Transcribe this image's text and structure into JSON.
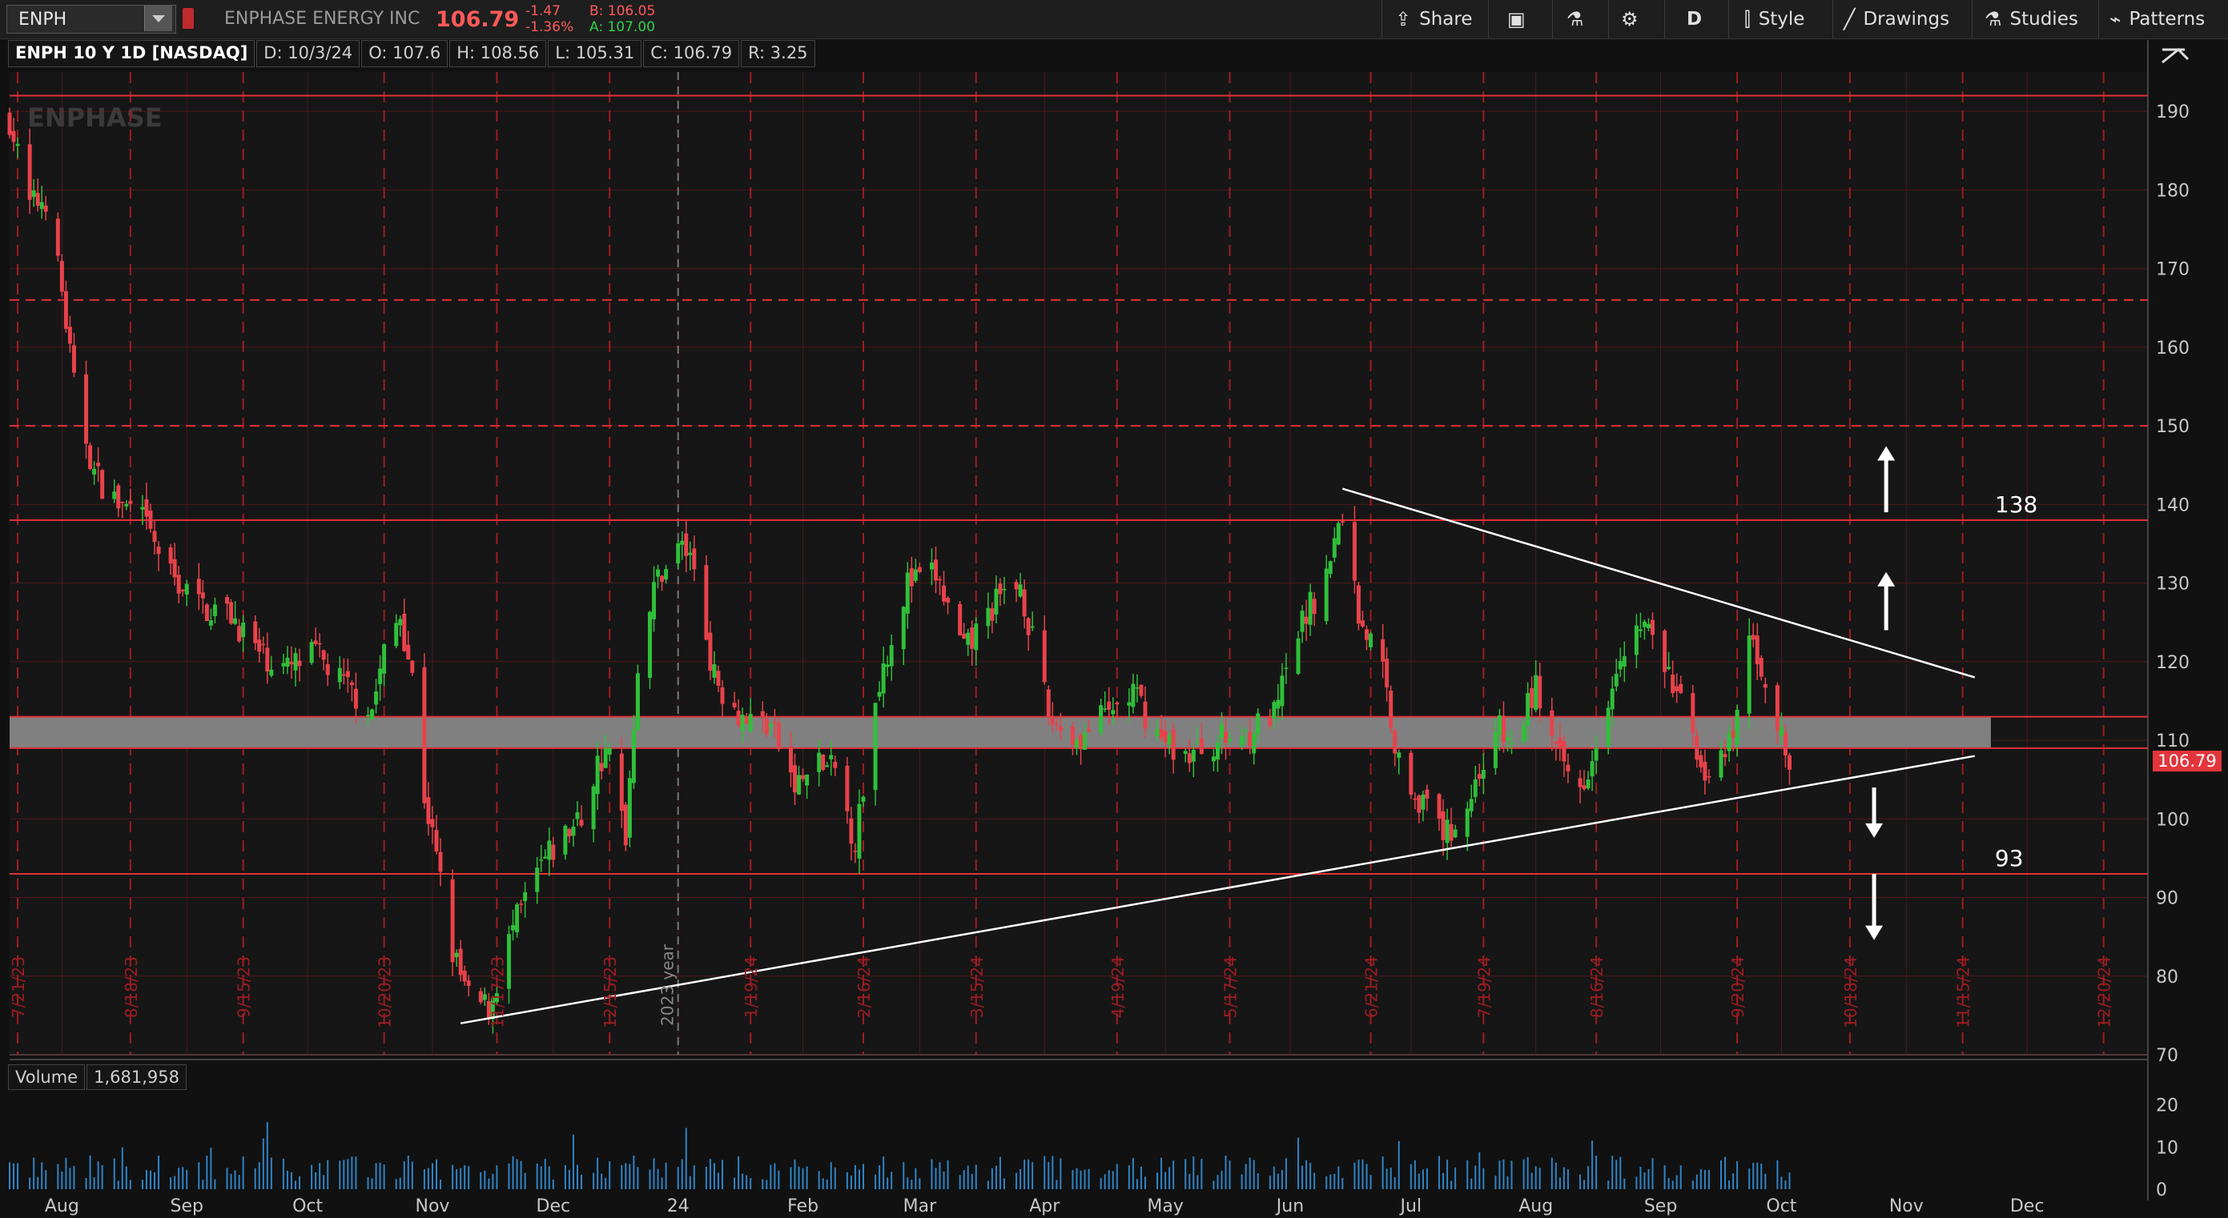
{
  "header": {
    "symbol": "ENPH",
    "company": "ENPHASE ENERGY INC",
    "last": "106.79",
    "change": "-1.47",
    "change_pct": "-1.36%",
    "bid": "B: 106.05",
    "ask": "A: 107.00",
    "toolbar": {
      "share": "Share",
      "interval": "D",
      "style": "Style",
      "drawings": "Drawings",
      "studies": "Studies",
      "patterns": "Patterns"
    }
  },
  "info": {
    "title": "ENPH 10 Y 1D [NASDAQ]",
    "date": "D: 10/3/24",
    "open": "O: 107.6",
    "high": "H: 108.56",
    "low": "L: 105.31",
    "close": "C: 106.79",
    "range": "R: 3.25"
  },
  "watermark": "ENPHASE",
  "volume": {
    "label": "Volume",
    "value": "1,681,958",
    "ticks": [
      "20",
      "10",
      "0"
    ]
  },
  "colors": {
    "up": "#2fbf3a",
    "down": "#e8424b",
    "grid": "#7a1a1e",
    "zone": "#808080",
    "trend": "#ffffff",
    "volume": "#2f84c6",
    "price_tag": "#e2363c"
  },
  "chart_data": {
    "type": "candlestick",
    "x_range": [
      "2023-07-19",
      "2024-12-31"
    ],
    "ylim": [
      70,
      195
    ],
    "y_ticks": [
      190,
      180,
      170,
      160,
      150,
      140,
      130,
      120,
      110,
      100,
      90,
      80,
      70
    ],
    "month_labels": [
      {
        "date": "2023-08-01",
        "label": "Aug"
      },
      {
        "date": "2023-09-01",
        "label": "Sep"
      },
      {
        "date": "2023-10-01",
        "label": "Oct"
      },
      {
        "date": "2023-11-01",
        "label": "Nov"
      },
      {
        "date": "2023-12-01",
        "label": "Dec"
      },
      {
        "date": "2024-01-01",
        "label": "24"
      },
      {
        "date": "2024-02-01",
        "label": "Feb"
      },
      {
        "date": "2024-03-01",
        "label": "Mar"
      },
      {
        "date": "2024-04-01",
        "label": "Apr"
      },
      {
        "date": "2024-05-01",
        "label": "May"
      },
      {
        "date": "2024-06-01",
        "label": "Jun"
      },
      {
        "date": "2024-07-01",
        "label": "Jul"
      },
      {
        "date": "2024-08-01",
        "label": "Aug"
      },
      {
        "date": "2024-09-01",
        "label": "Sep"
      },
      {
        "date": "2024-10-01",
        "label": "Oct"
      },
      {
        "date": "2024-11-01",
        "label": "Nov"
      },
      {
        "date": "2024-12-01",
        "label": "Dec"
      }
    ],
    "expiry_labels": [
      {
        "date": "2023-07-21",
        "label": "7/21/23"
      },
      {
        "date": "2023-08-18",
        "label": "8/18/23"
      },
      {
        "date": "2023-09-15",
        "label": "9/15/23"
      },
      {
        "date": "2023-10-20",
        "label": "10/20/23"
      },
      {
        "date": "2023-11-17",
        "label": "11/17/23"
      },
      {
        "date": "2023-12-15",
        "label": "12/15/23"
      },
      {
        "date": "2024-01-19",
        "label": "1/19/24"
      },
      {
        "date": "2024-02-16",
        "label": "2/16/24"
      },
      {
        "date": "2024-03-15",
        "label": "3/15/24"
      },
      {
        "date": "2024-04-19",
        "label": "4/19/24"
      },
      {
        "date": "2024-05-17",
        "label": "5/17/24"
      },
      {
        "date": "2024-06-21",
        "label": "6/21/24"
      },
      {
        "date": "2024-07-19",
        "label": "7/19/24"
      },
      {
        "date": "2024-08-16",
        "label": "8/16/24"
      },
      {
        "date": "2024-09-20",
        "label": "9/20/24"
      },
      {
        "date": "2024-10-18",
        "label": "10/18/24"
      },
      {
        "date": "2024-11-15",
        "label": "11/15/24"
      },
      {
        "date": "2024-12-20",
        "label": "12/20/24"
      }
    ],
    "year_marker": {
      "date": "2024-01-01",
      "label": "2023 year"
    },
    "h_lines_solid": [
      192,
      138,
      93
    ],
    "h_lines_dashed": [
      166,
      150
    ],
    "zone": [
      109,
      113
    ],
    "zone_end": "2024-11-22",
    "trendlines": [
      {
        "x1": "2023-11-08",
        "y1": 74,
        "x2": "2024-11-18",
        "y2": 108
      },
      {
        "x1": "2024-06-14",
        "y1": 142,
        "x2": "2024-11-18",
        "y2": 118
      }
    ],
    "arrows": [
      {
        "date": "2024-10-27",
        "from": 139,
        "to": 147,
        "dir": "up"
      },
      {
        "date": "2024-10-27",
        "from": 124,
        "to": 131,
        "dir": "up"
      },
      {
        "date": "2024-10-24",
        "from": 104,
        "to": 98,
        "dir": "down"
      },
      {
        "date": "2024-10-24",
        "from": 93,
        "to": 85,
        "dir": "down"
      }
    ],
    "level_labels": [
      {
        "date": "2024-11-23",
        "value": 138,
        "label": "138"
      },
      {
        "date": "2024-11-23",
        "value": 93,
        "label": "93"
      }
    ],
    "price_tag": "106.79",
    "series": [
      {
        "name": "ENPH",
        "points": [
          [
            "2023-07-19",
            189
          ],
          [
            "2023-07-24",
            178
          ],
          [
            "2023-07-28",
            179
          ],
          [
            "2023-08-01",
            167
          ],
          [
            "2023-08-04",
            155
          ],
          [
            "2023-08-09",
            144
          ],
          [
            "2023-08-15",
            140
          ],
          [
            "2023-08-21",
            138
          ],
          [
            "2023-08-28",
            131
          ],
          [
            "2023-09-05",
            127
          ],
          [
            "2023-09-12",
            126
          ],
          [
            "2023-09-19",
            121
          ],
          [
            "2023-09-26",
            119
          ],
          [
            "2023-10-03",
            121
          ],
          [
            "2023-10-10",
            117
          ],
          [
            "2023-10-17",
            114
          ],
          [
            "2023-10-20",
            121
          ],
          [
            "2023-10-24",
            126
          ],
          [
            "2023-10-27",
            118
          ],
          [
            "2023-10-30",
            103
          ],
          [
            "2023-11-02",
            95
          ],
          [
            "2023-11-06",
            83
          ],
          [
            "2023-11-10",
            77
          ],
          [
            "2023-11-15",
            76
          ],
          [
            "2023-11-21",
            86
          ],
          [
            "2023-11-28",
            94
          ],
          [
            "2023-12-04",
            98
          ],
          [
            "2023-12-08",
            100
          ],
          [
            "2023-12-12",
            107
          ],
          [
            "2023-12-15",
            108
          ],
          [
            "2023-12-19",
            98
          ],
          [
            "2023-12-22",
            120
          ],
          [
            "2023-12-27",
            131
          ],
          [
            "2024-01-02",
            135
          ],
          [
            "2024-01-05",
            132
          ],
          [
            "2024-01-10",
            118
          ],
          [
            "2024-01-17",
            113
          ],
          [
            "2024-01-24",
            112
          ],
          [
            "2024-01-30",
            104
          ],
          [
            "2024-02-05",
            107
          ],
          [
            "2024-02-09",
            106
          ],
          [
            "2024-02-14",
            97
          ],
          [
            "2024-02-20",
            118
          ],
          [
            "2024-02-27",
            130
          ],
          [
            "2024-03-05",
            131
          ],
          [
            "2024-03-12",
            121
          ],
          [
            "2024-03-19",
            127
          ],
          [
            "2024-03-26",
            130
          ],
          [
            "2024-04-02",
            113
          ],
          [
            "2024-04-09",
            110
          ],
          [
            "2024-04-16",
            113
          ],
          [
            "2024-04-23",
            116
          ],
          [
            "2024-04-30",
            110
          ],
          [
            "2024-05-07",
            108
          ],
          [
            "2024-05-14",
            110
          ],
          [
            "2024-05-21",
            111
          ],
          [
            "2024-05-28",
            113
          ],
          [
            "2024-06-04",
            125
          ],
          [
            "2024-06-10",
            131
          ],
          [
            "2024-06-14",
            139
          ],
          [
            "2024-06-18",
            126
          ],
          [
            "2024-06-24",
            119
          ],
          [
            "2024-06-28",
            107
          ],
          [
            "2024-07-05",
            101
          ],
          [
            "2024-07-10",
            98
          ],
          [
            "2024-07-16",
            103
          ],
          [
            "2024-07-22",
            112
          ],
          [
            "2024-07-26",
            109
          ],
          [
            "2024-08-01",
            117
          ],
          [
            "2024-08-06",
            108
          ],
          [
            "2024-08-12",
            104
          ],
          [
            "2024-08-16",
            110
          ],
          [
            "2024-08-22",
            122
          ],
          [
            "2024-08-28",
            125
          ],
          [
            "2024-09-03",
            118
          ],
          [
            "2024-09-09",
            111
          ],
          [
            "2024-09-13",
            104
          ],
          [
            "2024-09-19",
            110
          ],
          [
            "2024-09-23",
            123
          ],
          [
            "2024-09-27",
            118
          ],
          [
            "2024-10-02",
            108
          ],
          [
            "2024-10-03",
            106.79
          ]
        ]
      }
    ]
  }
}
